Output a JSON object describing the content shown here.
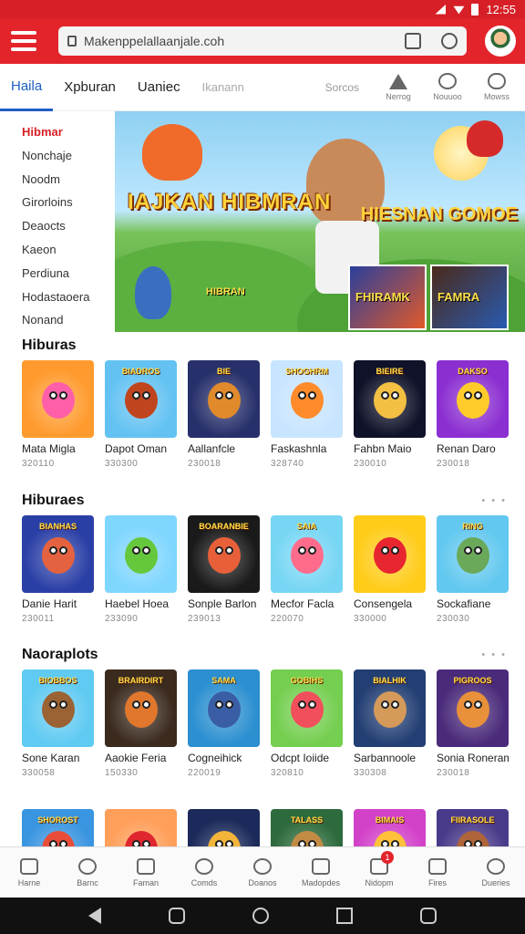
{
  "status_bar": {
    "time": "12:55"
  },
  "url_bar": {
    "url": "Makenppelallaanjale.coh"
  },
  "tabs": [
    {
      "label": "Haila",
      "active": true
    },
    {
      "label": "Xpburan",
      "active": false
    },
    {
      "label": "Uaniec",
      "active": false
    },
    {
      "label": "Ikanann",
      "active": false,
      "muted": true
    }
  ],
  "toolbar": {
    "sorts_label": "Sorcos",
    "tools": [
      {
        "label": "Nerrog",
        "icon": "send-icon"
      },
      {
        "label": "Nouuoo",
        "icon": "chat-icon"
      },
      {
        "label": "Mowss",
        "icon": "cloud-icon"
      }
    ]
  },
  "sidebar": {
    "items": [
      {
        "label": "Hibmar",
        "active": true
      },
      {
        "label": "Nonchaje"
      },
      {
        "label": "Noodm"
      },
      {
        "label": "Girorloins"
      },
      {
        "label": "Deaocts"
      },
      {
        "label": "Kaeon"
      },
      {
        "label": "Perdiuna"
      },
      {
        "label": "Hodastaoera"
      },
      {
        "label": "Nonand"
      }
    ]
  },
  "banner": {
    "title_left": "IAJKAN HIBMRAN",
    "title_right": "HIESNAN GOMOE",
    "poster1_label": "FHIRAMK",
    "poster2_label": "FAMRA",
    "small_label": "HIBRAN"
  },
  "sections": [
    {
      "title": "Hiburas",
      "show_more": false,
      "cards": [
        {
          "name": "Mata Migla",
          "count": "320110",
          "thumb_label": "",
          "bg": "#ff9b2e",
          "blob": "#ff5fa8"
        },
        {
          "name": "Dapot Oman",
          "count": "330300",
          "thumb_label": "BIADROS",
          "bg": "#63c2f2",
          "blob": "#c0451f"
        },
        {
          "name": "Aallanfcle",
          "count": "230018",
          "thumb_label": "BIE",
          "bg": "#27306b",
          "blob": "#e08a2c"
        },
        {
          "name": "Faskashnla",
          "count": "328740",
          "thumb_label": "SHOGHRM",
          "bg": "#c8e5ff",
          "blob": "#ff8b2b"
        },
        {
          "name": "Fahbn Maio",
          "count": "230010",
          "thumb_label": "BIEIRE",
          "bg": "#10122a",
          "blob": "#f4c043"
        },
        {
          "name": "Renan Daro",
          "count": "230018",
          "thumb_label": "DAKSO",
          "bg": "#8b2fd1",
          "blob": "#ffcb2a"
        }
      ]
    },
    {
      "title": "Hiburaes",
      "show_more": true,
      "more_label": "• • •",
      "cards": [
        {
          "name": "Danie Harit",
          "count": "230011",
          "thumb_label": "BIANHAS",
          "bg": "#2a3fa6",
          "blob": "#e4623f"
        },
        {
          "name": "Haebel Hoea",
          "count": "233090",
          "thumb_label": "",
          "bg": "#7fd6ff",
          "blob": "#65c83c"
        },
        {
          "name": "Sonple Barlon",
          "count": "239013",
          "thumb_label": "BOARANBIE",
          "bg": "#1a1a1a",
          "blob": "#e8603a"
        },
        {
          "name": "Mecfor Facla",
          "count": "220070",
          "thumb_label": "SAIA",
          "bg": "#77d6f4",
          "blob": "#ff6b8b"
        },
        {
          "name": "Consengela",
          "count": "330000",
          "thumb_label": "",
          "bg": "#ffcc1a",
          "blob": "#e8262f"
        },
        {
          "name": "Sockafiane",
          "count": "230030",
          "thumb_label": "RING",
          "bg": "#62c8ef",
          "blob": "#6aa85a"
        }
      ]
    },
    {
      "title": "Naoraplots",
      "show_more": true,
      "more_label": "• • •",
      "cards": [
        {
          "name": "Sone Karan",
          "count": "330058",
          "thumb_label": "BIOBBOS",
          "bg": "#5fcaf2",
          "blob": "#9b6233"
        },
        {
          "name": "Aaokie Feria",
          "count": "150330",
          "thumb_label": "BRAIRDIRT",
          "bg": "#3b2a1e",
          "blob": "#e0772c"
        },
        {
          "name": "Cogneihick",
          "count": "220019",
          "thumb_label": "SAMA",
          "bg": "#2b8fd0",
          "blob": "#3a5ea6"
        },
        {
          "name": "Odcpt Ioiide",
          "count": "320810",
          "thumb_label": "GOBIHS",
          "bg": "#74ce4f",
          "blob": "#f04f5b"
        },
        {
          "name": "Sarbannoole",
          "count": "330308",
          "thumb_label": "BIALHIK",
          "bg": "#223e73",
          "blob": "#d59a5a"
        },
        {
          "name": "Sonia Roneram",
          "count": "230018",
          "thumb_label": "PIGROOS",
          "bg": "#4a2a7a",
          "blob": "#e8903a"
        }
      ]
    },
    {
      "title": "",
      "show_more": false,
      "cards": [
        {
          "name": "",
          "count": "",
          "thumb_label": "SHOROST",
          "bg": "#3a95e0",
          "blob": "#e84d3a"
        },
        {
          "name": "",
          "count": "",
          "thumb_label": "",
          "bg": "#ff9f5a",
          "blob": "#e0262f"
        },
        {
          "name": "",
          "count": "",
          "thumb_label": "",
          "bg": "#1b2a5a",
          "blob": "#f2b53a"
        },
        {
          "name": "",
          "count": "",
          "thumb_label": "TALASS",
          "bg": "#2d6a3c",
          "blob": "#c28c44"
        },
        {
          "name": "",
          "count": "",
          "thumb_label": "BIMAIS",
          "bg": "#d242c9",
          "blob": "#ffc03a"
        },
        {
          "name": "",
          "count": "",
          "thumb_label": "FIIRASOLE",
          "bg": "#4a3a8a",
          "blob": "#b0643a"
        }
      ]
    }
  ],
  "bottom_nav": [
    {
      "label": "Harne",
      "icon": "home-icon"
    },
    {
      "label": "Barnc",
      "icon": "chat-bubble-icon"
    },
    {
      "label": "Faman",
      "icon": "shop-icon"
    },
    {
      "label": "Comds",
      "icon": "clock-icon"
    },
    {
      "label": "Doanos",
      "icon": "search-icon"
    },
    {
      "label": "Madopdes",
      "icon": "archive-icon"
    },
    {
      "label": "Nidopm",
      "icon": "camera-icon",
      "badge": "1"
    },
    {
      "label": "Fires",
      "icon": "document-icon"
    },
    {
      "label": "Dueries",
      "icon": "profile-icon"
    }
  ]
}
